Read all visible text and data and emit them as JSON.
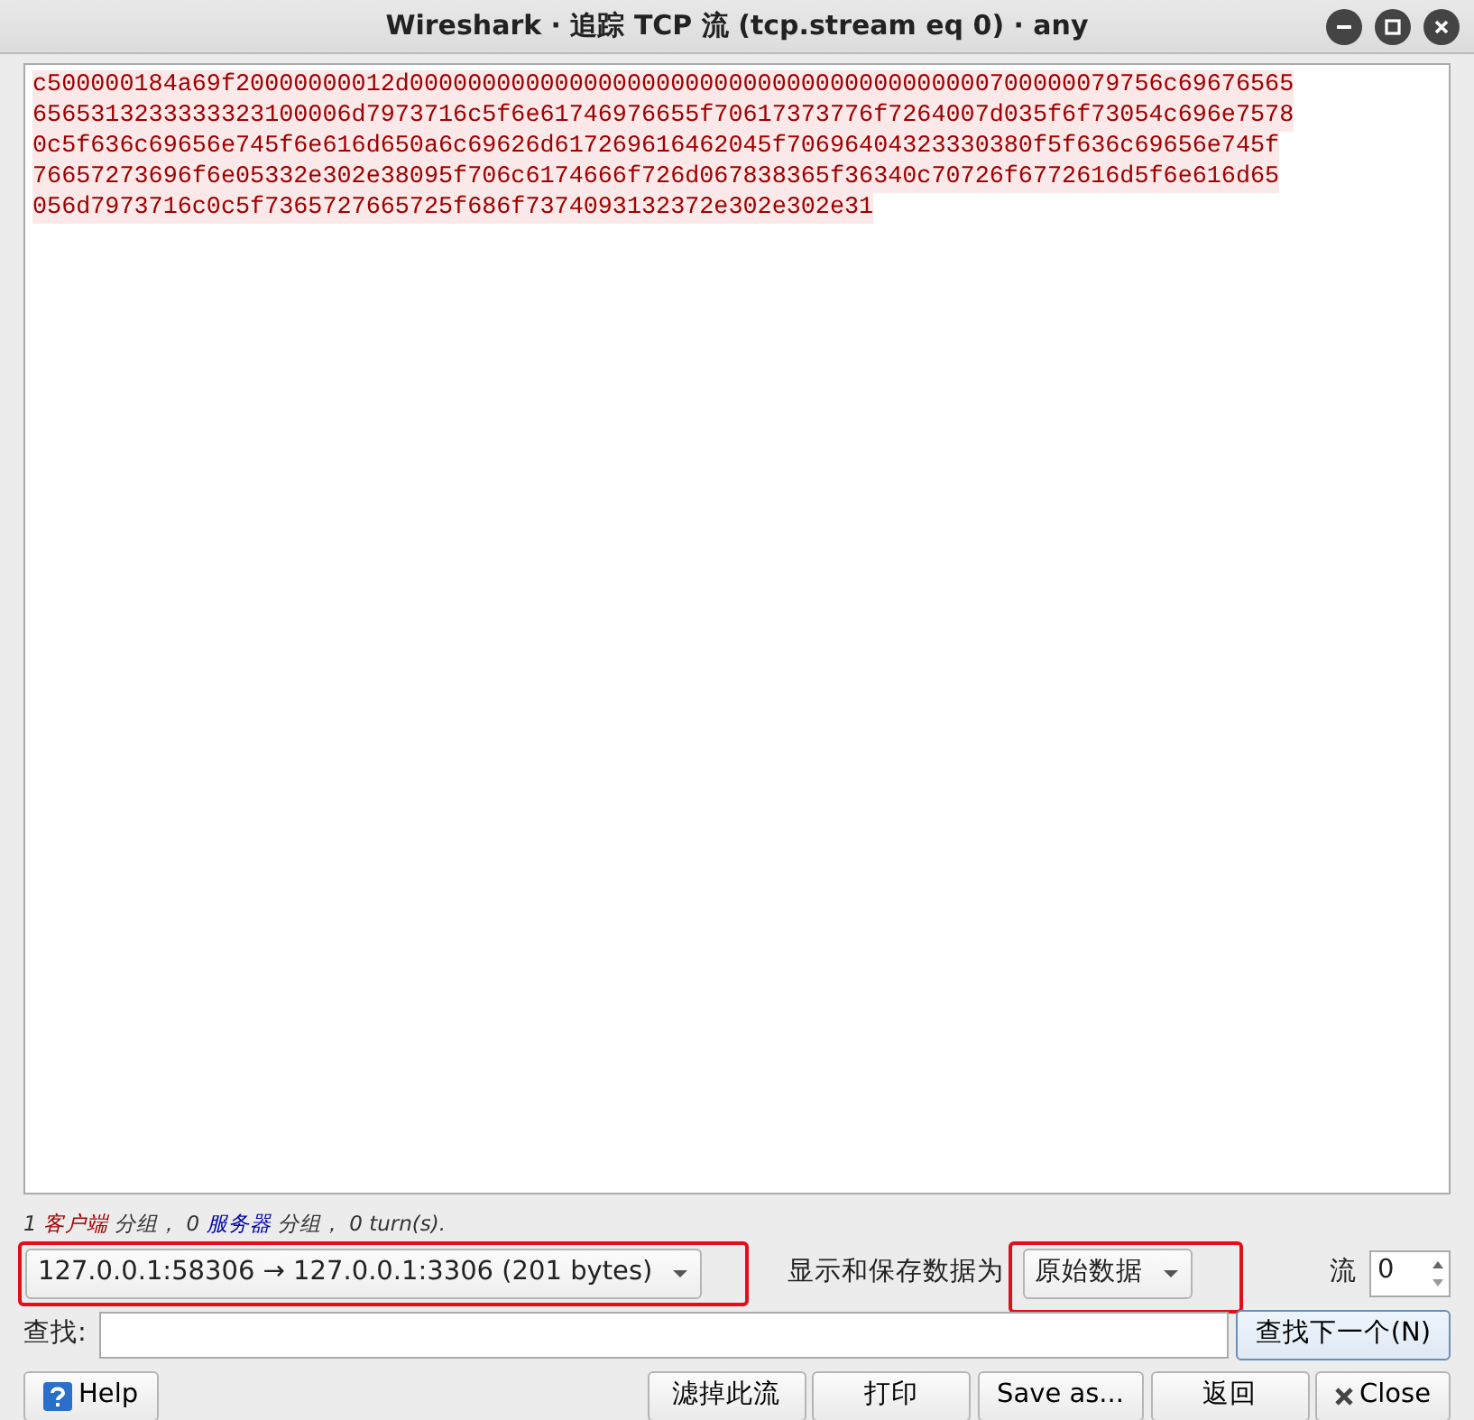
{
  "window": {
    "title": "Wireshark · 追踪 TCP 流 (tcp.stream eq 0) · any"
  },
  "stream_lines": [
    "c500000184a69f20000000012d0000000000000000000000000000000000000000700000079756c69676565",
    "6565313233333323100006d7973716c5f6e61746976655f70617373776f7264007d035f6f73054c696e7578",
    "0c5f636c69656e745f6e616d650a6c69626d617269616462045f70696404323330380f5f636c69656e745f",
    "76657273696f6e05332e302e38095f706c6174666f726d067838365f36340c70726f6772616d5f6e616d65",
    "056d7973716c0c5f7365727665725f686f7374093132372e302e302e31"
  ],
  "summary": [
    {
      "kind": "count",
      "text": "1"
    },
    {
      "kind": "client",
      "text": "客户端"
    },
    {
      "kind": "plain",
      "text": "分组，"
    },
    {
      "kind": "count",
      "text": "0"
    },
    {
      "kind": "server",
      "text": "服务器"
    },
    {
      "kind": "plain",
      "text": "分组，"
    },
    {
      "kind": "count",
      "text": "0 turn(s)."
    }
  ],
  "stream_select": {
    "value": "127.0.0.1:58306 → 127.0.0.1:3306 (201 bytes)",
    "highlighted": true
  },
  "format": {
    "label": "显示和保存数据为",
    "value": "原始数据",
    "highlighted": true
  },
  "stream_number": {
    "label": "流",
    "value": "0"
  },
  "find": {
    "label": "查找:",
    "button": "查找下一个(N)"
  },
  "buttons": [
    {
      "kind": "help",
      "label": "Help"
    },
    {
      "kind": "spacer"
    },
    {
      "kind": "plain",
      "label": "滤掉此流"
    },
    {
      "kind": "plain",
      "label": "打印"
    },
    {
      "kind": "plain",
      "label": "Save as..."
    },
    {
      "kind": "plain",
      "label": "返回"
    },
    {
      "kind": "close",
      "label": "Close"
    }
  ]
}
